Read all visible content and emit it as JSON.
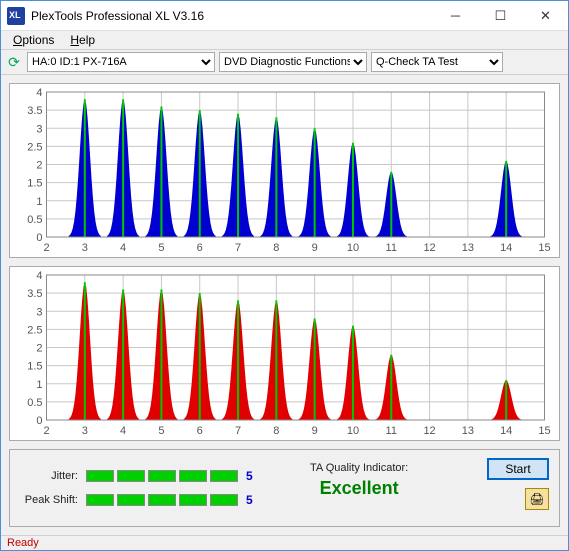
{
  "window": {
    "title": "PlexTools Professional XL V3.16"
  },
  "menu": {
    "options": "Options",
    "help": "Help"
  },
  "toolbar": {
    "drive": "HA:0 ID:1   PX-716A",
    "func": "DVD Diagnostic Functions",
    "test": "Q-Check TA Test"
  },
  "metrics": {
    "jitter_label": "Jitter:",
    "jitter_value": "5",
    "peak_label": "Peak Shift:",
    "peak_value": "5"
  },
  "ta": {
    "label": "TA Quality Indicator:",
    "value": "Excellent"
  },
  "buttons": {
    "start": "Start"
  },
  "status": "Ready",
  "chart_data": [
    {
      "type": "bar",
      "title": "",
      "xlabel": "",
      "ylabel": "",
      "xlim": [
        2,
        15
      ],
      "ylim": [
        0,
        4
      ],
      "xticks": [
        2,
        3,
        4,
        5,
        6,
        7,
        8,
        9,
        10,
        11,
        12,
        13,
        14,
        15
      ],
      "yticks": [
        0,
        0.5,
        1,
        1.5,
        2,
        2.5,
        3,
        3.5,
        4
      ],
      "peaks": [
        3,
        4,
        5,
        6,
        7,
        8,
        9,
        10,
        11,
        14
      ],
      "heights": [
        3.8,
        3.8,
        3.6,
        3.5,
        3.4,
        3.3,
        3.0,
        2.6,
        1.8,
        2.1
      ],
      "spread": 0.42,
      "fill": "#0000d0"
    },
    {
      "type": "bar",
      "title": "",
      "xlabel": "",
      "ylabel": "",
      "xlim": [
        2,
        15
      ],
      "ylim": [
        0,
        4
      ],
      "xticks": [
        2,
        3,
        4,
        5,
        6,
        7,
        8,
        9,
        10,
        11,
        12,
        13,
        14,
        15
      ],
      "yticks": [
        0,
        0.5,
        1,
        1.5,
        2,
        2.5,
        3,
        3.5,
        4
      ],
      "peaks": [
        3,
        4,
        5,
        6,
        7,
        8,
        9,
        10,
        11,
        14
      ],
      "heights": [
        3.8,
        3.6,
        3.6,
        3.5,
        3.3,
        3.3,
        2.8,
        2.6,
        1.8,
        1.1
      ],
      "spread": 0.42,
      "fill": "#e00000"
    }
  ]
}
